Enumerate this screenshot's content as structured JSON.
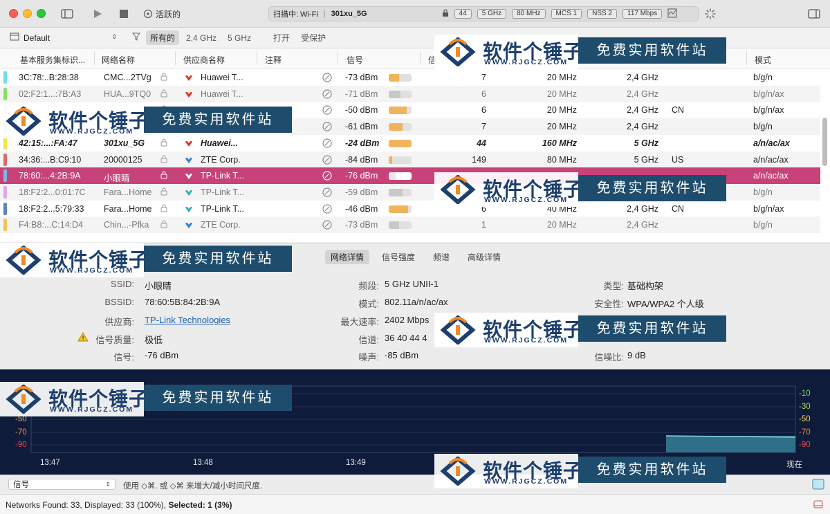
{
  "toolbar": {
    "active_label": "活跃的",
    "scan_label": "扫描中: Wi-Fi",
    "scan_network": "301xu_5G",
    "pills": [
      "44",
      "5 GHz",
      "80 MHz",
      "MCS 1",
      "NSS 2",
      "117 Mbps"
    ]
  },
  "filterbar": {
    "profile": "Default",
    "filters": [
      "所有的",
      "2,4 GHz",
      "5 GHz",
      "打开",
      "受保护"
    ]
  },
  "table": {
    "headers": [
      "基本服务集标识...",
      "网络名称",
      "供应商名称",
      "注释",
      "信号",
      "信",
      "模式"
    ],
    "rows": [
      {
        "bssid": "3C:78:..B:28:38",
        "ssid": "CMC...2TVg",
        "vendor": "Huawei T...",
        "signal": "-73 dBm",
        "channel": "7",
        "width": "20 MHz",
        "band": "2,4 GHz",
        "country": "",
        "mode": "b/g/n",
        "color": "#6fe0e6",
        "vendor_color": "#e0322c",
        "level": 0.45,
        "style": "normal"
      },
      {
        "bssid": "02:F2:1...:7B:A3",
        "ssid": "HUA...9TQ0",
        "vendor": "Huawei T...",
        "signal": "-71 dBm",
        "channel": "6",
        "width": "20 MHz",
        "band": "2,4 GHz",
        "country": "",
        "mode": "b/g/n/ax",
        "color": "#8adf66",
        "vendor_color": "#e0322c",
        "level": 0.5,
        "style": "dim"
      },
      {
        "bssid": "",
        "ssid": "",
        "vendor": "",
        "signal": "-50 dBm",
        "channel": "6",
        "width": "20 MHz",
        "band": "2,4 GHz",
        "country": "CN",
        "mode": "b/g/n/ax",
        "color": "#f3a0c0",
        "vendor_color": "#2ca4c8",
        "level": 0.8,
        "style": "normal"
      },
      {
        "bssid": "",
        "ssid": "",
        "vendor": "",
        "signal": "-61 dBm",
        "channel": "7",
        "width": "20 MHz",
        "band": "2,4 GHz",
        "country": "",
        "mode": "b/g/n",
        "color": "#bba4e8",
        "vendor_color": "#2ca4c8",
        "level": 0.6,
        "style": "normal"
      },
      {
        "bssid": "42:15:...:FA:47",
        "ssid": "301xu_5G",
        "vendor": "Huawei...",
        "signal": "-24 dBm",
        "channel": "44",
        "width": "160 MHz",
        "band": "5 GHz",
        "country": "",
        "mode": "a/n/ac/ax",
        "color": "#f4e24a",
        "vendor_color": "#e0322c",
        "level": 1.0,
        "style": "bold"
      },
      {
        "bssid": "34:36:...B:C9:10",
        "ssid": "20000125",
        "vendor": "ZTE Corp.",
        "signal": "-84 dBm",
        "channel": "149",
        "width": "80 MHz",
        "band": "5 GHz",
        "country": "US",
        "mode": "a/n/ac/ax",
        "color": "#d66b6b",
        "vendor_color": "#2a7fd4",
        "level": 0.15,
        "style": "normal"
      },
      {
        "bssid": "78:60:...4:2B:9A",
        "ssid": "小眼睛",
        "vendor": "TP-Link T...",
        "signal": "-76 dBm",
        "channel": "",
        "width": "",
        "band": "",
        "country": "",
        "mode": "a/n/ac/ax",
        "color": "#7fb6ea",
        "vendor_color": "#ffffff",
        "level": 0.3,
        "style": "selected"
      },
      {
        "bssid": "18:F2:2...0:01:7C",
        "ssid": "Fara...Home",
        "vendor": "TP-Link T...",
        "signal": "-59 dBm",
        "channel": "",
        "width": "",
        "band": "",
        "country": "",
        "mode": "b/g/n",
        "color": "#e0a8e8",
        "vendor_color": "#2ab0b8",
        "level": 0.6,
        "style": "dim"
      },
      {
        "bssid": "18:F2:2...5:79:33",
        "ssid": "Fara...Home",
        "vendor": "TP-Link T...",
        "signal": "-46 dBm",
        "channel": "6",
        "width": "40 MHz",
        "band": "2,4 GHz",
        "country": "CN",
        "mode": "b/g/n/ax",
        "color": "#5b84b8",
        "vendor_color": "#2ab0b8",
        "level": 0.85,
        "style": "normal"
      },
      {
        "bssid": "F4:B8:...C:14:D4",
        "ssid": "Chin...-Pfka",
        "vendor": "ZTE Corp.",
        "signal": "-73 dBm",
        "channel": "1",
        "width": "20 MHz",
        "band": "2,4 GHz",
        "country": "",
        "mode": "b/g/n",
        "color": "#f3c25c",
        "vendor_color": "#2a7fd4",
        "level": 0.45,
        "style": "dim"
      }
    ]
  },
  "details": {
    "tabs": [
      "网络详情",
      "信号强度",
      "频谱",
      "高级详情"
    ],
    "left": [
      {
        "label": "SSID:",
        "value": "小眼睛"
      },
      {
        "label": "BSSID:",
        "value": "78:60:5B:84:2B:9A"
      },
      {
        "label": "供应商:",
        "value": "TP-Link Technologies"
      },
      {
        "label": "信号质量:",
        "value": "极低"
      },
      {
        "label": "信号:",
        "value": "-76 dBm"
      }
    ],
    "middle": [
      {
        "label": "频段:",
        "value": "5 GHz UNII-1"
      },
      {
        "label": "模式:",
        "value": "802.11a/n/ac/ax"
      },
      {
        "label": "最大速率:",
        "value": "2402 Mbps"
      },
      {
        "label": "信道:",
        "value": "36 40 44 4"
      },
      {
        "label": "噪声:",
        "value": "-85 dBm"
      }
    ],
    "right": [
      {
        "label": "类型:",
        "value": "基础构架"
      },
      {
        "label": "安全性:",
        "value": "WPA/WPA2 个人级"
      },
      {
        "label": "信噪比:",
        "value": "9 dB"
      }
    ]
  },
  "graph": {
    "y_left": [
      "-50",
      "-70",
      "-90"
    ],
    "y_right": [
      "-10",
      "-30",
      "-50",
      "-70",
      "-90"
    ],
    "x_ticks": [
      "13:47",
      "13:48",
      "13:49",
      "现在"
    ]
  },
  "bottom": {
    "select_value": "信号",
    "hint": "使用 ◇⌘. 或 ◇⌘ 来增大/减小时间尺度."
  },
  "status": {
    "prefix": "Networks Found: 33, Displayed: 33 (100%), ",
    "selected": "Selected: 1 (3%)"
  },
  "watermark": {
    "name": "软件个锤子",
    "url": "WWW.RJGCZ.COM",
    "slogan": "免费实用软件站"
  }
}
